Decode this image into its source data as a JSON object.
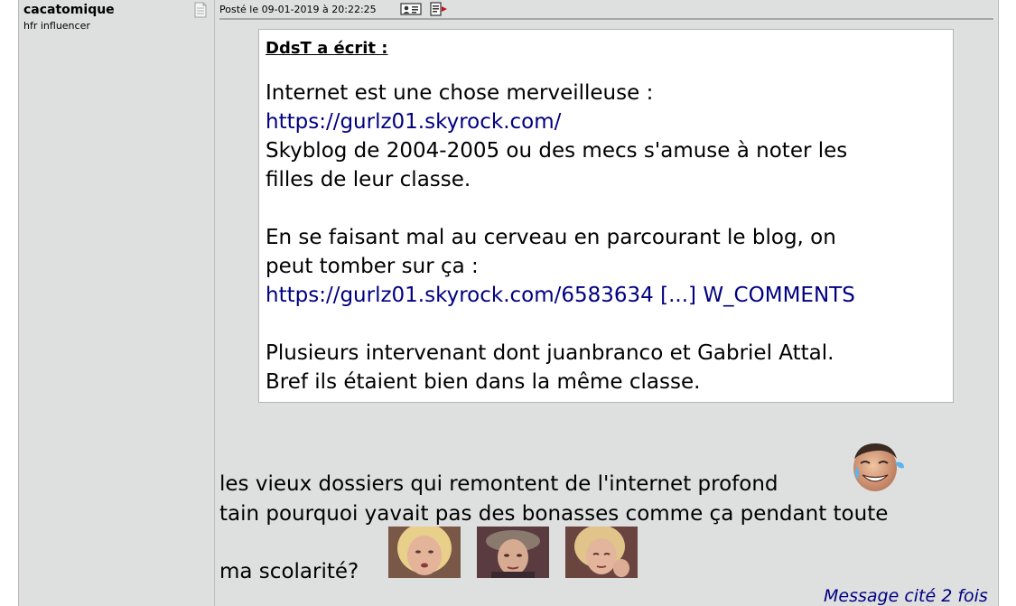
{
  "profile": {
    "username": "cacatomique",
    "user_title": "hfr influencer",
    "profile_icon": "document-icon"
  },
  "post": {
    "header": "Posté le 09-01-2019 à 20:22:25",
    "header_icons": [
      "profile-card-icon",
      "quote-reply-icon"
    ]
  },
  "quote": {
    "author": "DdsT a écrit :",
    "lines": [
      "Internet est une chose merveilleuse :",
      "https://gurlz01.skyrock.com/",
      "Skyblog de 2004-2005 ou des mecs s'amuse à noter les",
      "filles de leur classe.",
      "En se faisant mal au cerveau en parcourant le blog, on",
      "peut tomber sur ça :",
      "https://gurlz01.skyrock.com/6583634 [...] W_COMMENTS",
      "Plusieurs intervenant dont juanbranco et Gabriel Attal.",
      "Bref ils étaient bien dans la même classe."
    ]
  },
  "message": {
    "line1": "les vieux dossiers qui remontent de l'internet profond",
    "line2": "tain pourquoi yavait pas des bonasses comme ça pendant toute",
    "line3": "ma scolarité?",
    "smiley": "crying-laughing-face-icon",
    "images": [
      "blonde-woman-photo",
      "woman-with-hat-photo",
      "woman-leaning-photo"
    ]
  },
  "footer": {
    "cited": "Message cité 2 fois"
  },
  "colors": {
    "post_background": "#dedfdf",
    "link": "#000080",
    "quote_background": "#ffffff"
  }
}
